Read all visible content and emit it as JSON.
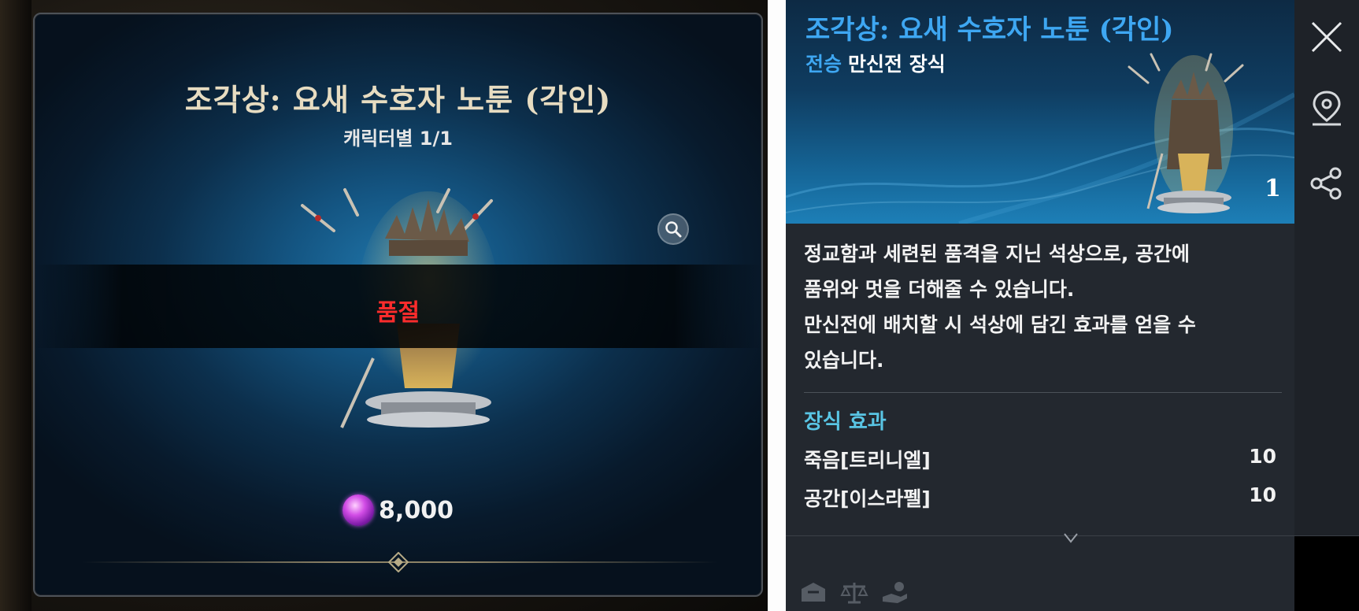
{
  "shop": {
    "title": "조각상: 요새 수호자 노툰 (각인)",
    "purchase_limit": "캐릭터별  1/1",
    "sold_out_label": "품절",
    "price": "8,000",
    "currency_icon": "purple-gem-icon",
    "zoom_icon": "magnifier-icon"
  },
  "tooltip": {
    "title": "조각상: 요새 수호자 노툰 (각인)",
    "grade": "전승",
    "category": "만신전 장식",
    "quantity": "1",
    "description": [
      "정교함과 세련된 품격을 지닌 석상으로, 공간에",
      "품위와 멋을 더해줄 수 있습니다.",
      "만신전에 배치할 시 석상에 담긴 효과를 얻을 수",
      "있습니다."
    ],
    "effect_heading": "장식 효과",
    "effects": [
      {
        "name": "죽음[트리니엘]",
        "value": "10"
      },
      {
        "name": "공간[이스라펠]",
        "value": "10"
      }
    ],
    "footer_icons": [
      "storage-box-icon",
      "scale-icon",
      "hand-coin-icon"
    ]
  },
  "actions": {
    "close_icon": "close-icon",
    "locate_icon": "map-pin-icon",
    "share_icon": "share-icon"
  },
  "colors": {
    "title_gold": "#e7dcc1",
    "sold_out_red": "#ff2c2c",
    "legendary_blue": "#3ea7f2",
    "effect_heading": "#59c5e4",
    "panel_bg": "#23282f"
  }
}
